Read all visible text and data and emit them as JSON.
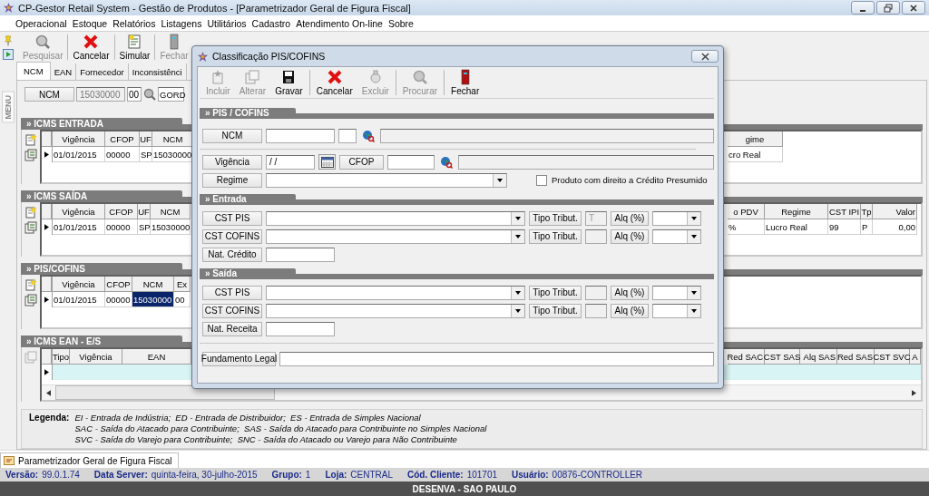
{
  "window": {
    "title": "CP-Gestor Retail System - Gestão de Produtos - [Parametrizador Geral de Figura Fiscal]"
  },
  "menu": [
    "Operacional",
    "Estoque",
    "Relatórios",
    "Listagens",
    "Utilitários",
    "Cadastro",
    "Atendimento On-line",
    "Sobre"
  ],
  "side_tab": "MENU",
  "toolbar": [
    {
      "kind": "search",
      "label": "Pesquisar",
      "disabled": true
    },
    {
      "kind": "cancel",
      "label": "Cancelar",
      "disabled": false
    },
    {
      "kind": "simulate",
      "label": "Simular",
      "disabled": false
    },
    {
      "kind": "close",
      "label": "Fechar",
      "disabled": true
    }
  ],
  "tabs": [
    {
      "label": "NCM",
      "selected": true
    },
    {
      "label": "EAN",
      "selected": false
    },
    {
      "label": "Fornecedor",
      "selected": false
    },
    {
      "label": "Inconsistênci",
      "selected": false
    }
  ],
  "ncm_filter": {
    "label": "NCM",
    "code": "15030000",
    "ex": "00",
    "description": "GORD"
  },
  "panels": [
    {
      "title": "» ICMS ENTRADA",
      "tools_disabled": false,
      "blank_row": false,
      "left_columns": [
        "Vigência",
        "CFOP",
        "UF",
        "NCM"
      ],
      "left_rows": [
        [
          {
            "text": "01/01/2015",
            "selected": false
          },
          {
            "text": "00000",
            "selected": false
          },
          {
            "text": "SP",
            "selected": false
          },
          {
            "text": "15030000",
            "selected": false
          }
        ]
      ],
      "right_columns": [
        "gime"
      ],
      "right_rows": [
        [
          {
            "text": "cro Real",
            "selected": false
          }
        ]
      ]
    },
    {
      "title": "» ICMS SAÍDA",
      "tools_disabled": false,
      "blank_row": false,
      "left_columns": [
        "Vigência",
        "CFOP",
        "UF",
        "NCM"
      ],
      "left_rows": [
        [
          {
            "text": "01/01/2015",
            "selected": false
          },
          {
            "text": "00000",
            "selected": false
          },
          {
            "text": "SP",
            "selected": false
          },
          {
            "text": "15030000",
            "selected": false
          }
        ]
      ],
      "right_columns": [
        "o PDV",
        "Regime",
        "CST IPI",
        "Tp",
        "Valor"
      ],
      "right_rows": [
        [
          {
            "text": "%",
            "selected": false
          },
          {
            "text": "Lucro Real",
            "selected": false
          },
          {
            "text": "99",
            "selected": false
          },
          {
            "text": "P",
            "selected": false
          },
          {
            "text": "0,00",
            "selected": false
          }
        ]
      ]
    },
    {
      "title": "» PIS/COFINS",
      "tools_disabled": false,
      "blank_row": false,
      "left_columns": [
        "Vigência",
        "CFOP",
        "NCM",
        "Ex"
      ],
      "left_rows": [
        [
          {
            "text": "01/01/2015",
            "selected": false
          },
          {
            "text": "00000",
            "selected": false
          },
          {
            "text": "15030000",
            "selected": true
          },
          {
            "text": "00",
            "selected": false
          }
        ]
      ]
    },
    {
      "title": "» ICMS EAN - E/S",
      "tools_disabled": true,
      "blank_row": true,
      "left_columns": [
        "Tipo",
        "Vigência",
        "EAN"
      ],
      "right_columns": [
        "Red SAC",
        "CST SAS",
        "Alq SAS",
        "Red SAS",
        "CST SVC",
        "A"
      ]
    }
  ],
  "legend": {
    "label": "Legenda:",
    "lines": [
      "EI - Entrada de Indústria;  ED - Entrada de Distribuidor;  ES - Entrada de Simples Nacional",
      "SAC - Saída do Atacado para Contribuinte;  SAS - Saída do Atacado para Contribuinte no Simples Nacional",
      "SVC - Saída do Varejo para Contribuinte;  SNC - Saída do Atacado ou Varejo para Não Contribuinte"
    ]
  },
  "taskbar": {
    "tab": "Parametrizador Geral de Figura Fiscal"
  },
  "status": [
    {
      "label": "Versão:",
      "value": "99.0.1.74"
    },
    {
      "label": "Data Server:",
      "value": "quinta-feira, 30-julho-2015"
    },
    {
      "label": "Grupo:",
      "value": "1"
    },
    {
      "label": "Loja:",
      "value": "CENTRAL"
    },
    {
      "label": "Cód. Cliente:",
      "value": "101701"
    },
    {
      "label": "Usuário:",
      "value": "00876-CONTROLLER"
    }
  ],
  "footer": "DESENVA - SAO PAULO",
  "dialog": {
    "title": "Classificação PIS/COFINS",
    "toolbar": [
      {
        "kind": "add",
        "label": "Incluir",
        "disabled": true
      },
      {
        "kind": "edit",
        "label": "Alterar",
        "disabled": true
      },
      {
        "kind": "save",
        "label": "Gravar",
        "disabled": false
      },
      {
        "kind": "cancel",
        "label": "Cancelar",
        "disabled": false
      },
      {
        "kind": "delete",
        "label": "Excluir",
        "disabled": true
      },
      {
        "kind": "search",
        "label": "Procurar",
        "disabled": true
      },
      {
        "kind": "close",
        "label": "Fechar",
        "disabled": false
      }
    ],
    "header": {
      "title": "» PIS / COFINS",
      "ncm_label": "NCM",
      "vigencia_label": "Vigência",
      "vigencia_value": "/ /",
      "cfop_label": "CFOP",
      "regime_label": "Regime",
      "presumido": {
        "label": "Produto com direito a Crédito Presumido",
        "checked": false
      }
    },
    "sections": [
      {
        "title": "» Entrada",
        "rows": [
          {
            "label": "CST PIS",
            "tipo_label": "Tipo Tribut.",
            "tipo_value": "T",
            "alq_label": "Alq (%)"
          },
          {
            "label": "CST COFINS",
            "tipo_label": "Tipo Tribut.",
            "alq_label": "Alq (%)"
          }
        ],
        "nat_label": "Nat. Crédito"
      },
      {
        "title": "» Saída",
        "rows": [
          {
            "label": "CST PIS",
            "tipo_label": "Tipo Tribut.",
            "alq_label": "Alq (%)"
          },
          {
            "label": "CST COFINS",
            "tipo_label": "Tipo Tribut.",
            "alq_label": "Alq (%)"
          }
        ],
        "nat_label": "Nat. Receita"
      }
    ],
    "fundamento_label": "Fundamento Legal"
  }
}
